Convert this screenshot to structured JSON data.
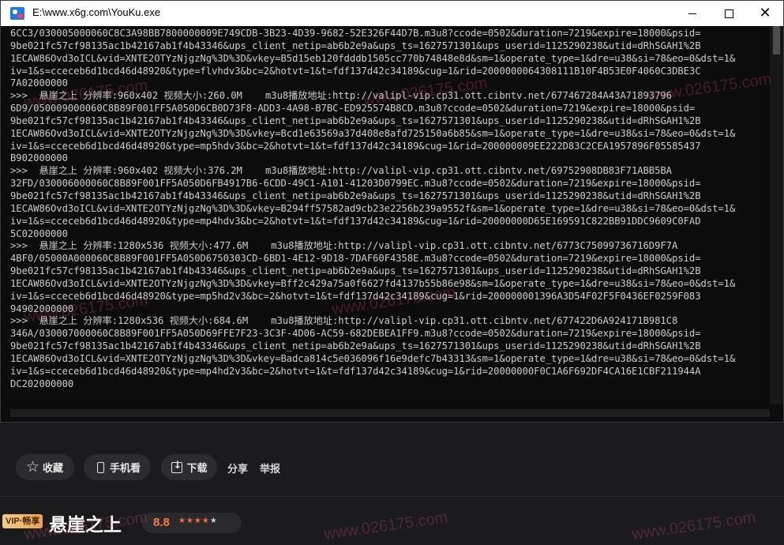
{
  "window": {
    "title": "E:\\www.x6g.com\\YouKu.exe",
    "minimize_glyph": "",
    "close_glyph": "✕"
  },
  "console": {
    "lines": [
      "6CC3/030005000060C8C3A98BB7800000009E749CDB-3B23-4D39-9682-52E326F44D7B.m3u8?ccode=0502&duration=7219&expire=18000&psid=",
      "9be021fc57cf98135ac1b42167ab1f4b43346&ups_client_netip=ab6b2e9a&ups_ts=1627571301&ups_userid=1125290238&utid=dRhSGAH1%2B",
      "1ECAW86Ovd3oICL&vid=XNTE2OTYzNjgzNg%3D%3D&vkey=B5d15eb120fdddb1505cc770b74848e8d&sm=1&operate_type=1&dre=u38&si=78&eo=0&dst=1&",
      "iv=1&s=cceceb6d1bcd46d48920&type=flvhdv3&bc=2&hotvt=1&t=fdf137d42c34189&cug=1&rid=2000000064308111B10F4B53E0F4060C3DBE3C",
      "7A02000000",
      ">>>  悬崖之上 分辨率:960x402 视频大小:260.0M    m3u8播放地址:http://valipl-vip.cp31.ott.cibntv.net/677467284A43A71893796",
      "6D9/050009000060C8B89F001FF5A050D6CB0D73F8-ADD3-4A98-B7BC-ED925574B8CD.m3u8?ccode=0502&duration=7219&expire=18000&psid=",
      "9be021fc57cf98135ac1b42167ab1f4b43346&ups_client_netip=ab6b2e9a&ups_ts=1627571301&ups_userid=1125290238&utid=dRhSGAH1%2B",
      "1ECAW86Ovd3oICL&vid=XNTE2OTYzNjgzNg%3D%3D&vkey=Bcd1e63569a37d408e8afd725150a6b85&sm=1&operate_type=1&dre=u38&si=78&eo=0&dst=1&",
      "iv=1&s=cceceb6d1bcd46d48920&type=mp5hdv3&bc=2&hotvt=1&t=fdf137d42c34189&cug=1&rid=200000009EE222D83C2CEA1957896F05585437",
      "B902000000",
      ">>>  悬崖之上 分辨率:960x402 视频大小:376.2M    m3u8播放地址:http://valipl-vip.cp31.ott.cibntv.net/69752908DB83F71ABB5BA",
      "32FD/030006000060C8B89F001FF5A050D6FB4917B6-6CDD-49C1-A101-41203D0799EC.m3u8?ccode=0502&duration=7219&expire=18000&psid=",
      "9be021fc57cf98135ac1b42167ab1f4b43346&ups_client_netip=ab6b2e9a&ups_ts=1627571301&ups_userid=1125290238&utid=dRhSGAH1%2B",
      "1ECAW86Ovd3oICL&vid=XNTE2OTYzNjgzNg%3D%3D&vkey=B294ff57582ad9cb23e2256b239a9552f&sm=1&operate_type=1&dre=u38&si=78&eo=0&dst=1&",
      "iv=1&s=cceceb6d1bcd46d48920&type=mp4hdv3&bc=2&hotvt=1&t=fdf137d42c34189&cug=1&rid=20000000D65E169591C822BB91DDC9609C0FAD",
      "5C02000000",
      ">>>  悬崖之上 分辨率:1280x536 视频大小:477.6M    m3u8播放地址:http://valipl-vip.cp31.ott.cibntv.net/6773C75099736716D9F7A",
      "4BF0/05000A000060C8B89F001FF5A050D6750303CD-6BD1-4E12-9D18-7DAF60F4358E.m3u8?ccode=0502&duration=7219&expire=18000&psid=",
      "9be021fc57cf98135ac1b42167ab1f4b43346&ups_client_netip=ab6b2e9a&ups_ts=1627571301&ups_userid=1125290238&utid=dRhSGAH1%2B",
      "1ECAW86Ovd3oICL&vid=XNTE2OTYzNjgzNg%3D%3D&vkey=Bff2c429a75a0f6627fd4137b55b86e98&sm=1&operate_type=1&dre=u38&si=78&eo=0&dst=1&",
      "iv=1&s=cceceb6d1bcd46d48920&type=mp5hd2v3&bc=2&hotvt=1&t=fdf137d42c34189&cug=1&rid=200000001396A3D54F02F5F0436EF0259F083",
      "94902000000",
      ">>>  悬崖之上 分辨率:1280x536 视频大小:684.6M    m3u8播放地址:http://valipl-vip.cp31.ott.cibntv.net/677422D6A924171B981C8",
      "346A/030007000060C8B89F001FF5A050D69FFE7F23-3C3F-4D06-AC59-682DEBEA1FF9.m3u8?ccode=0502&duration=7219&expire=18000&psid=",
      "9be021fc57cf98135ac1b42167ab1f4b43346&ups_client_netip=ab6b2e9a&ups_ts=1627571301&ups_userid=1125290238&utid=dRhSGAH1%2B",
      "1ECAW86Ovd3oICL&vid=XNTE2OTYzNjgzNg%3D%3D&vkey=Badca814c5e036096f16e9defc7b43313&sm=1&operate_type=1&dre=u38&si=78&eo=0&dst=1&",
      "iv=1&s=cceceb6d1bcd46d48920&type=mp4hd2v3&bc=2&hotvt=1&t=fdf137d42c34189&cug=1&rid=20000000F0C1A6F692DF4CA16E1CBF211944A",
      "DC202000000"
    ]
  },
  "actions": {
    "favorite": "收藏",
    "mobile": "手机看",
    "download": "下载",
    "share": "分享",
    "report": "举报"
  },
  "show": {
    "vip_badge": "VIP·畅享",
    "title": "悬崖之上",
    "score": "8.8",
    "stars_full": "★★★★",
    "stars_empty": "★"
  },
  "watermark": "www.026175.com",
  "colors": {
    "accent": "#ff7a3d",
    "vip_gold": "#e7a25a",
    "console_bg": "#0c0c0c",
    "console_fg": "#cccccc"
  }
}
